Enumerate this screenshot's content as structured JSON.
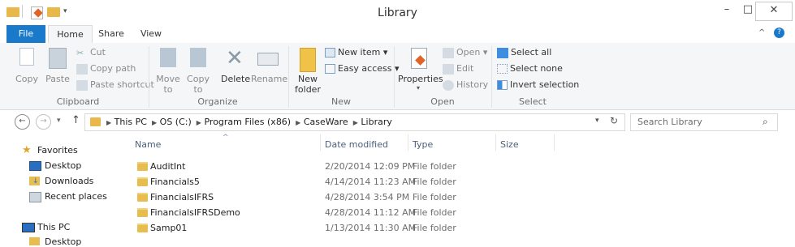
{
  "window": {
    "title": "Library"
  },
  "tabs": [
    {
      "label": "File"
    },
    {
      "label": "Home"
    },
    {
      "label": "Share"
    },
    {
      "label": "View"
    }
  ],
  "ribbon": {
    "clipboard": {
      "copy": "Copy",
      "paste": "Paste",
      "cut": "Cut",
      "copy_path": "Copy path",
      "paste_shortcut": "Paste shortcut",
      "label": "Clipboard"
    },
    "organize": {
      "move_to": "Move",
      "move_to2": "to",
      "copy_to": "Copy",
      "copy_to2": "to",
      "delete": "Delete",
      "rename": "Rename",
      "label": "Organize"
    },
    "new": {
      "new_folder": "New",
      "new_folder2": "folder",
      "new_item": "New item",
      "easy_access": "Easy access",
      "label": "New"
    },
    "open": {
      "properties": "Properties",
      "open": "Open",
      "edit": "Edit",
      "history": "History",
      "label": "Open"
    },
    "select": {
      "select_all": "Select all",
      "select_none": "Select none",
      "invert": "Invert selection",
      "label": "Select"
    }
  },
  "address": {
    "crumbs": [
      "This PC",
      "OS (C:)",
      "Program Files (x86)",
      "CaseWare",
      "Library"
    ],
    "search_placeholder": "Search Library"
  },
  "nav": {
    "favorites": "Favorites",
    "items": [
      "Desktop",
      "Downloads",
      "Recent places"
    ],
    "this_pc": "This PC",
    "partial": "Desktop"
  },
  "columns": {
    "name": "Name",
    "date": "Date modified",
    "type": "Type",
    "size": "Size"
  },
  "files": [
    {
      "name": "AuditInt",
      "date": "2/20/2014 12:09 PM",
      "type": "File folder"
    },
    {
      "name": "Financials5",
      "date": "4/14/2014 11:23 AM",
      "type": "File folder"
    },
    {
      "name": "FinancialsIFRS",
      "date": "4/28/2014 3:54 PM",
      "type": "File folder"
    },
    {
      "name": "FinancialsIFRSDemo",
      "date": "4/28/2014 11:12 AM",
      "type": "File folder"
    },
    {
      "name": "Samp01",
      "date": "1/13/2014 11:30 AM",
      "type": "File folder"
    }
  ],
  "colors": {
    "accent": "#1979ca",
    "folder": "#e8bd4f"
  }
}
